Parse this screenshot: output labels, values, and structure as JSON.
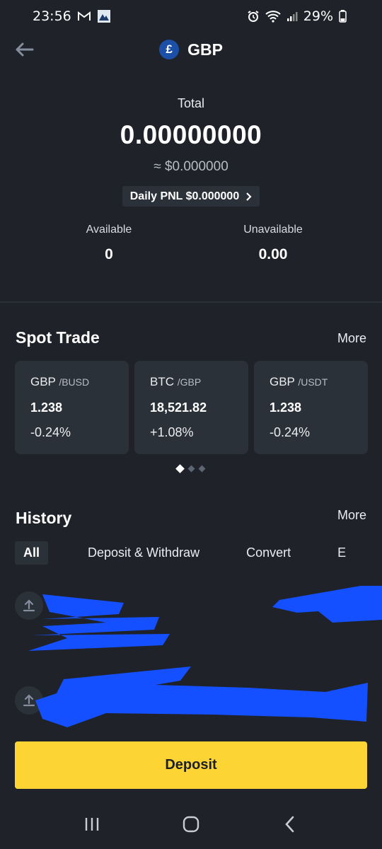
{
  "status_bar": {
    "time": "23:56",
    "battery": "29%"
  },
  "header": {
    "coin_symbol": "£",
    "title": "GBP"
  },
  "balance": {
    "total_label": "Total",
    "total_value": "0.00000000",
    "total_usd": "≈ $0.000000",
    "daily_pnl": "Daily PNL $0.000000",
    "available_label": "Available",
    "available_value": "0",
    "unavailable_label": "Unavailable",
    "unavailable_value": "0.00"
  },
  "spot_trade": {
    "title": "Spot Trade",
    "more": "More",
    "cards": [
      {
        "base": "GBP",
        "quote": "/BUSD",
        "price": "1.238",
        "change": "-0.24%"
      },
      {
        "base": "BTC",
        "quote": "/GBP",
        "price": "18,521.82",
        "change": "+1.08%"
      },
      {
        "base": "GBP",
        "quote": "/USDT",
        "price": "1.238",
        "change": "-0.24%"
      }
    ]
  },
  "history": {
    "title": "History",
    "more": "More",
    "tabs": [
      "All",
      "Deposit & Withdraw",
      "Convert",
      "E"
    ]
  },
  "deposit_label": "Deposit",
  "colors": {
    "accent": "#fcd535",
    "background": "#1f2329",
    "card": "#2b3139",
    "redaction": "#1450ff"
  }
}
